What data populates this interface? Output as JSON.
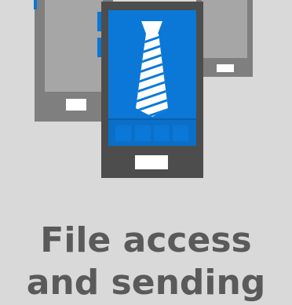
{
  "illustration": {
    "name": "mobile-devices-with-tie-illustration",
    "colors": {
      "background": "#d9d9d9",
      "device_dark": "#4d4d4d",
      "device_mid": "#7f7f7f",
      "screen_light": "#a6a6a6",
      "accent_blue": "#0b78d7",
      "white": "#ffffff"
    }
  },
  "caption": {
    "line1": "File access",
    "line2": "and sending"
  }
}
